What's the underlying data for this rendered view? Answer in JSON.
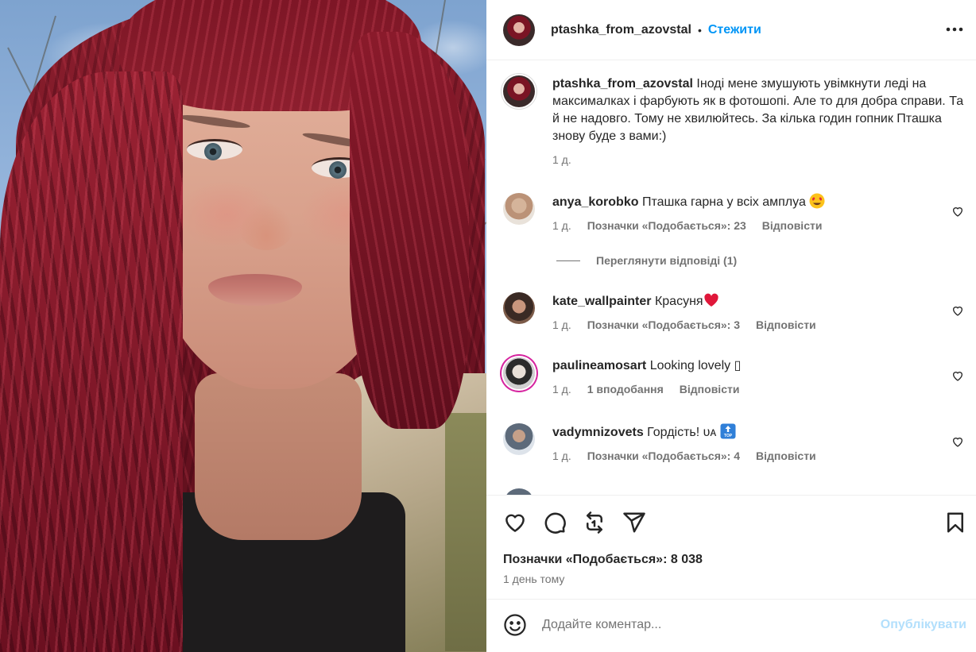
{
  "post": {
    "author": "ptashka_from_azovstal",
    "follow_label": "Стежити",
    "dot": "•",
    "caption": "Іноді мене змушують увімкнути леді на максималках і фарбують як в фотошопі. Але то для добра справи. Та й не надовго. Тому не хвилюйтесь. За кілька годин гопник Пташка знову буде з вами:)",
    "caption_age": "1 д."
  },
  "comments": [
    {
      "user": "anya_korobko",
      "text": "Пташка гарна у всіх амплуа",
      "emoji": "heart-eyes",
      "age": "1 д.",
      "likes": "Позначки «Подобається»: 23",
      "reply": "Відповісти"
    },
    {
      "user": "kate_wallpainter",
      "text": "Красуня",
      "emoji": "red-heart",
      "age": "1 д.",
      "likes": "Позначки «Подобається»: 3",
      "reply": "Відповісти"
    },
    {
      "user": "paulineamosart",
      "text": "Looking lovely ▯",
      "emoji": "",
      "age": "1 д.",
      "likes": "1 вподобання",
      "reply": "Відповісти"
    },
    {
      "user": "vadymnizovets",
      "text": "Гордість! ᴜᴀ",
      "emoji": "top-arrow",
      "age": "1 д.",
      "likes": "Позначки «Подобається»: 4",
      "reply": "Відповісти"
    }
  ],
  "view_replies": "Переглянути відповіді (1)",
  "actions": {
    "likes": "Позначки «Подобається»: 8 038",
    "posted": "1 день тому"
  },
  "composer": {
    "placeholder": "Додайте коментар...",
    "publish": "Опублікувати"
  },
  "icons": [
    "heart-icon",
    "comment-icon",
    "repost-icon",
    "share-icon",
    "bookmark-icon",
    "emoji-icon",
    "more-icon"
  ],
  "colors": {
    "accent": "#0095f6",
    "publish_disabled": "#b2dffc",
    "muted": "#737373",
    "text": "#262626"
  }
}
